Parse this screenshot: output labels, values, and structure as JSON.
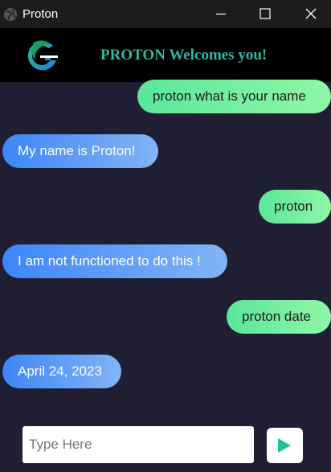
{
  "window": {
    "title": "Proton",
    "icon": "globe-icon",
    "controls": [
      "minimize-icon",
      "maximize-icon",
      "close-icon"
    ]
  },
  "header": {
    "logo": "proton-logo",
    "title": "PROTON Welcomes you!",
    "title_color": "#2fb8a0"
  },
  "messages": [
    {
      "sender": "user",
      "text": "proton what is your name"
    },
    {
      "sender": "bot",
      "text": "My name is Proton!"
    },
    {
      "sender": "user",
      "text": "proton"
    },
    {
      "sender": "bot",
      "text": "I am not functioned to do this !"
    },
    {
      "sender": "user",
      "text": "proton date"
    },
    {
      "sender": "bot",
      "text": "April 24, 2023"
    }
  ],
  "input": {
    "placeholder": "Type Here",
    "value": ""
  },
  "send_button": {
    "icon": "play-send-icon",
    "color": "#1fc29b"
  },
  "colors": {
    "background": "#1f1e33",
    "user_bubble": "#6ff0a0",
    "bot_bubble": "#4a8ff7"
  }
}
